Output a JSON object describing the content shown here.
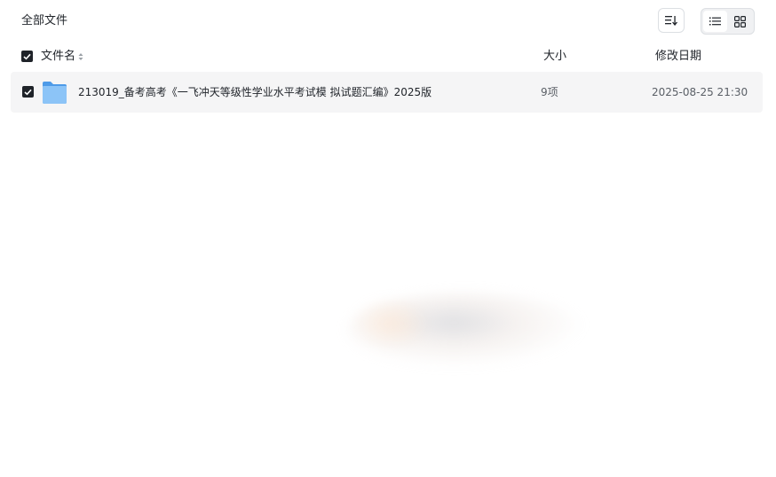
{
  "header": {
    "breadcrumb": "全部文件",
    "sort_icon": "sort-descending-icon",
    "view_list_icon": "list-view-icon",
    "view_grid_icon": "grid-view-icon",
    "active_view": "list"
  },
  "columns": {
    "name": "文件名",
    "size": "大小",
    "date": "修改日期"
  },
  "files": [
    {
      "name": "213019_备考高考《一飞冲天等级性学业水平考试模 拟试题汇编》2025版",
      "size": "9项",
      "date": "2025-08-25 21:30",
      "type": "folder",
      "checked": true
    }
  ],
  "colors": {
    "folder": "#6aaef0",
    "checkbox": "#1f2329",
    "row_bg": "#f5f5f6"
  }
}
